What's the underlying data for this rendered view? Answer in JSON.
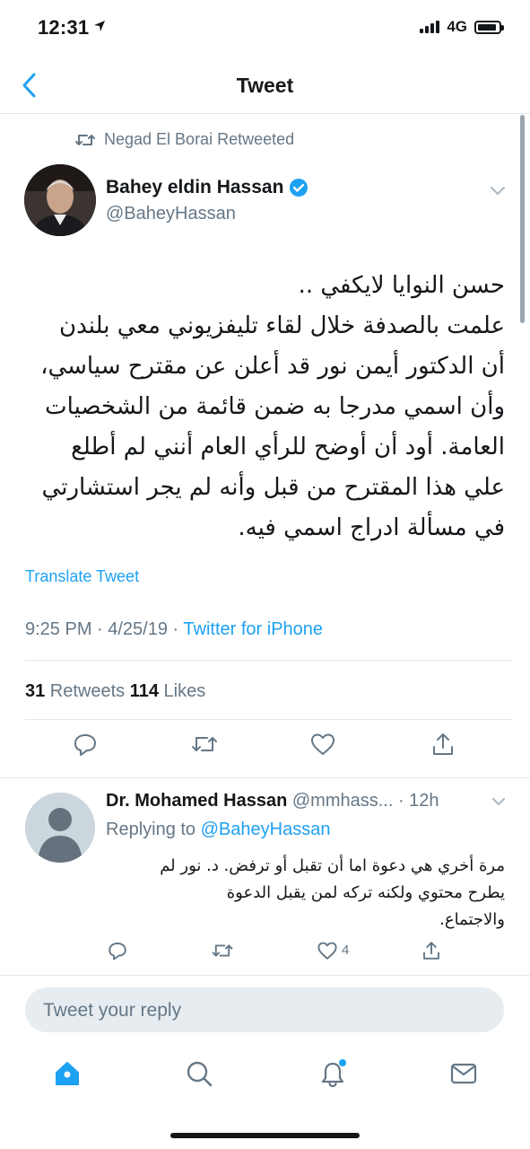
{
  "status": {
    "time": "12:31",
    "network": "4G"
  },
  "nav": {
    "title": "Tweet",
    "back_icon": "chevron-left-icon"
  },
  "tweet": {
    "retweeted_by": "Negad El Borai Retweeted",
    "author_name": "Bahey eldin Hassan",
    "author_handle": "@BaheyHassan",
    "text": "حسن النوايا لايكفي ..\nعلمت بالصدفة خلال لقاء تليفزيوني معي بلندن\nأن الدكتور أيمن نور قد أعلن عن مقترح سياسي،\nوأن اسمي مدرجا به ضمن قائمة من الشخصيات\nالعامة. أود أن أوضح للرأي العام أنني لم أطلع\nعلي هذا المقترح من قبل وأنه لم يجر استشارتي\nفي مسألة ادراج اسمي فيه.",
    "translate_label": "Translate Tweet",
    "time": "9:25 PM · 4/25/19 · ",
    "source": "Twitter for iPhone",
    "retweets_count": "31",
    "retweets_label": " Retweets ",
    "likes_count": "114",
    "likes_label": " Likes"
  },
  "reply": {
    "author_name": "Dr. Mohamed Hassan",
    "author_handle": " @mmhass... ",
    "time": "· 12h",
    "replying_prefix": "Replying to ",
    "replying_to": "@BaheyHassan",
    "text": "مرة أخري هي دعوة اما أن تقبل أو ترفض. د. نور لم\nيطرح محتوي ولكنه تركه لمن يقبل الدعوة\nوالاجتماع.",
    "likes": "4"
  },
  "composer": {
    "placeholder": "Tweet your reply"
  },
  "colors": {
    "accent": "#1da1f2",
    "secondary_text": "#657786",
    "divider": "#e1e8ed"
  }
}
